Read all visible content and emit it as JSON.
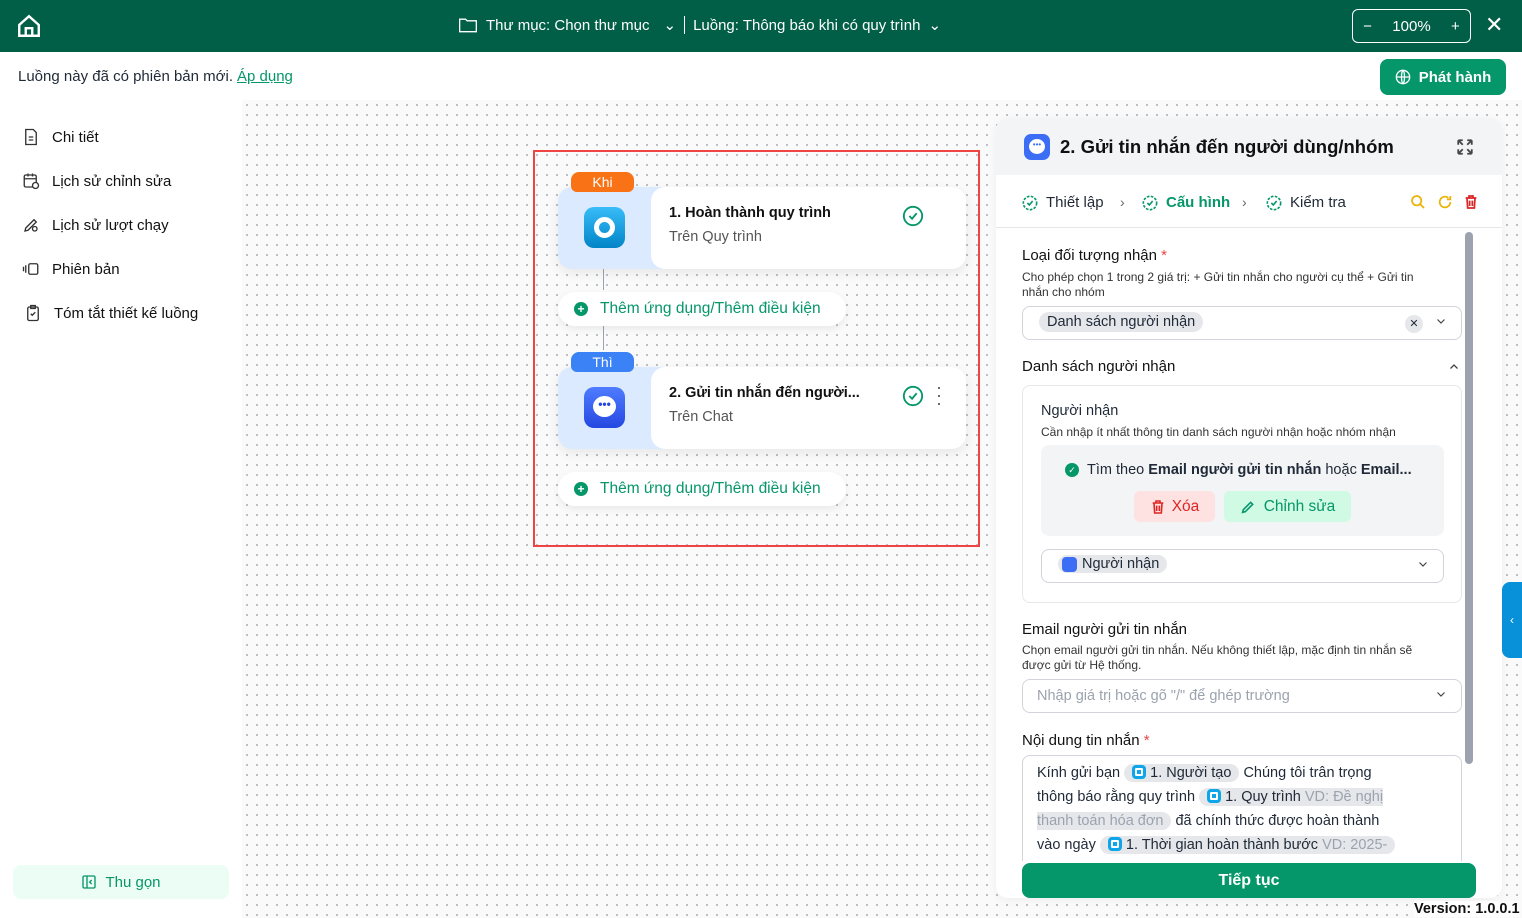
{
  "header": {
    "folder_label": "Thư mục: Chọn thư mục",
    "flow_label": "Luồng: Thông báo khi có quy trình",
    "zoom": "100%",
    "zoom_minus": "−",
    "zoom_plus": "+",
    "close": "✕"
  },
  "notice": {
    "text": "Luồng này đã có phiên bản mới.",
    "link": "Áp dụng"
  },
  "publish_label": "Phát hành",
  "sidebar": {
    "items": [
      {
        "label": "Chi tiết"
      },
      {
        "label": "Lịch sử chỉnh sửa"
      },
      {
        "label": "Lịch sử lượt chạy"
      },
      {
        "label": "Phiên bản"
      },
      {
        "label": "Tóm tắt thiết kế luồng"
      }
    ],
    "collapse": "Thu gọn"
  },
  "flow": {
    "nodes": [
      {
        "tag": "Khi",
        "title": "1.  Hoàn thành quy trình",
        "subtitle": "Trên Quy trình"
      },
      {
        "tag": "Thì",
        "title": "2.  Gửi tin nhắn đến người...",
        "subtitle": "Trên Chat"
      }
    ],
    "add_label": "Thêm ứng dụng/Thêm điều kiện"
  },
  "panel": {
    "title": "2. Gửi tin nhắn đến người dùng/nhóm",
    "steps": [
      "Thiết lập",
      "Cấu hình",
      "Kiểm tra"
    ],
    "recipient_type": {
      "label": "Loại đối tượng nhận",
      "required": "*",
      "help": "Cho phép chọn 1 trong 2 giá trị: + Gửi tin nhắn cho người cụ thể + Gửi tin nhắn cho nhóm",
      "value": "Danh sách người nhận"
    },
    "recipient_list": {
      "label": "Danh sách người nhận",
      "sub_label": "Người nhận",
      "help": "Cần nhập ít nhất thông tin danh sách người nhận hoặc nhóm nhận",
      "rule_prefix": "Tìm theo ",
      "rule_bold1": "Email người gửi tin nhắn",
      "rule_mid": " hoặc ",
      "rule_bold2": "Email...",
      "delete": "Xóa",
      "edit": "Chỉnh sửa",
      "chip": "Người nhận"
    },
    "sender_email": {
      "label": "Email người gửi tin nhắn",
      "help": "Chọn email người gửi tin nhắn. Nếu không thiết lập, mặc định tin nhắn sẽ được gửi từ Hệ thống.",
      "placeholder": "Nhập giá trị hoặc gõ \"/\" để ghép trường"
    },
    "message": {
      "label": "Nội dung tin nhắn",
      "required": "*",
      "t1": "Kính gửi bạn",
      "chip1": "1. Người tạo",
      "t2": "Chúng tôi trân trọng",
      "t3": "thông báo rằng quy trình",
      "chip2": "1. Quy trình",
      "chip2_hint": "VD: Đề nghị",
      "chip2_hint2": "thanh toán hóa đơn",
      "t4": "đã chính thức được hoàn thành",
      "t5": "vào ngày",
      "chip3": "1. Thời gian hoàn thành bước",
      "chip3_hint": "VD: 2025-"
    },
    "continue": "Tiếp tục"
  },
  "version": "Version: 1.0.0.1",
  "colors": {
    "header": "#005f46",
    "accent": "#059669",
    "danger": "#ef4444",
    "warning": "#eab308"
  }
}
